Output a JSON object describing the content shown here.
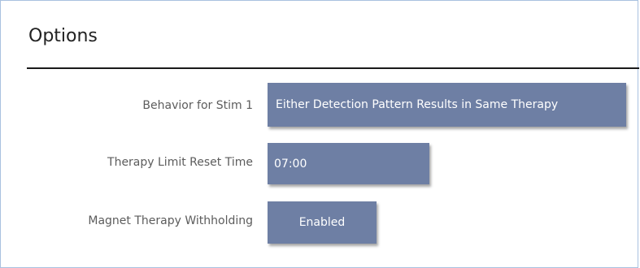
{
  "options": {
    "title": "Options",
    "rows": [
      {
        "label": "Behavior for Stim 1",
        "value": "Either Detection Pattern Results in Same Therapy"
      },
      {
        "label": "Therapy Limit Reset Time",
        "value": "07:00"
      },
      {
        "label": "Magnet Therapy Withholding",
        "value": "Enabled"
      }
    ]
  },
  "colors": {
    "button_fill": "#6e7fa4",
    "button_text": "#ffffff",
    "panel_border": "#a9c1e0",
    "label_text": "#5c5c5c"
  }
}
